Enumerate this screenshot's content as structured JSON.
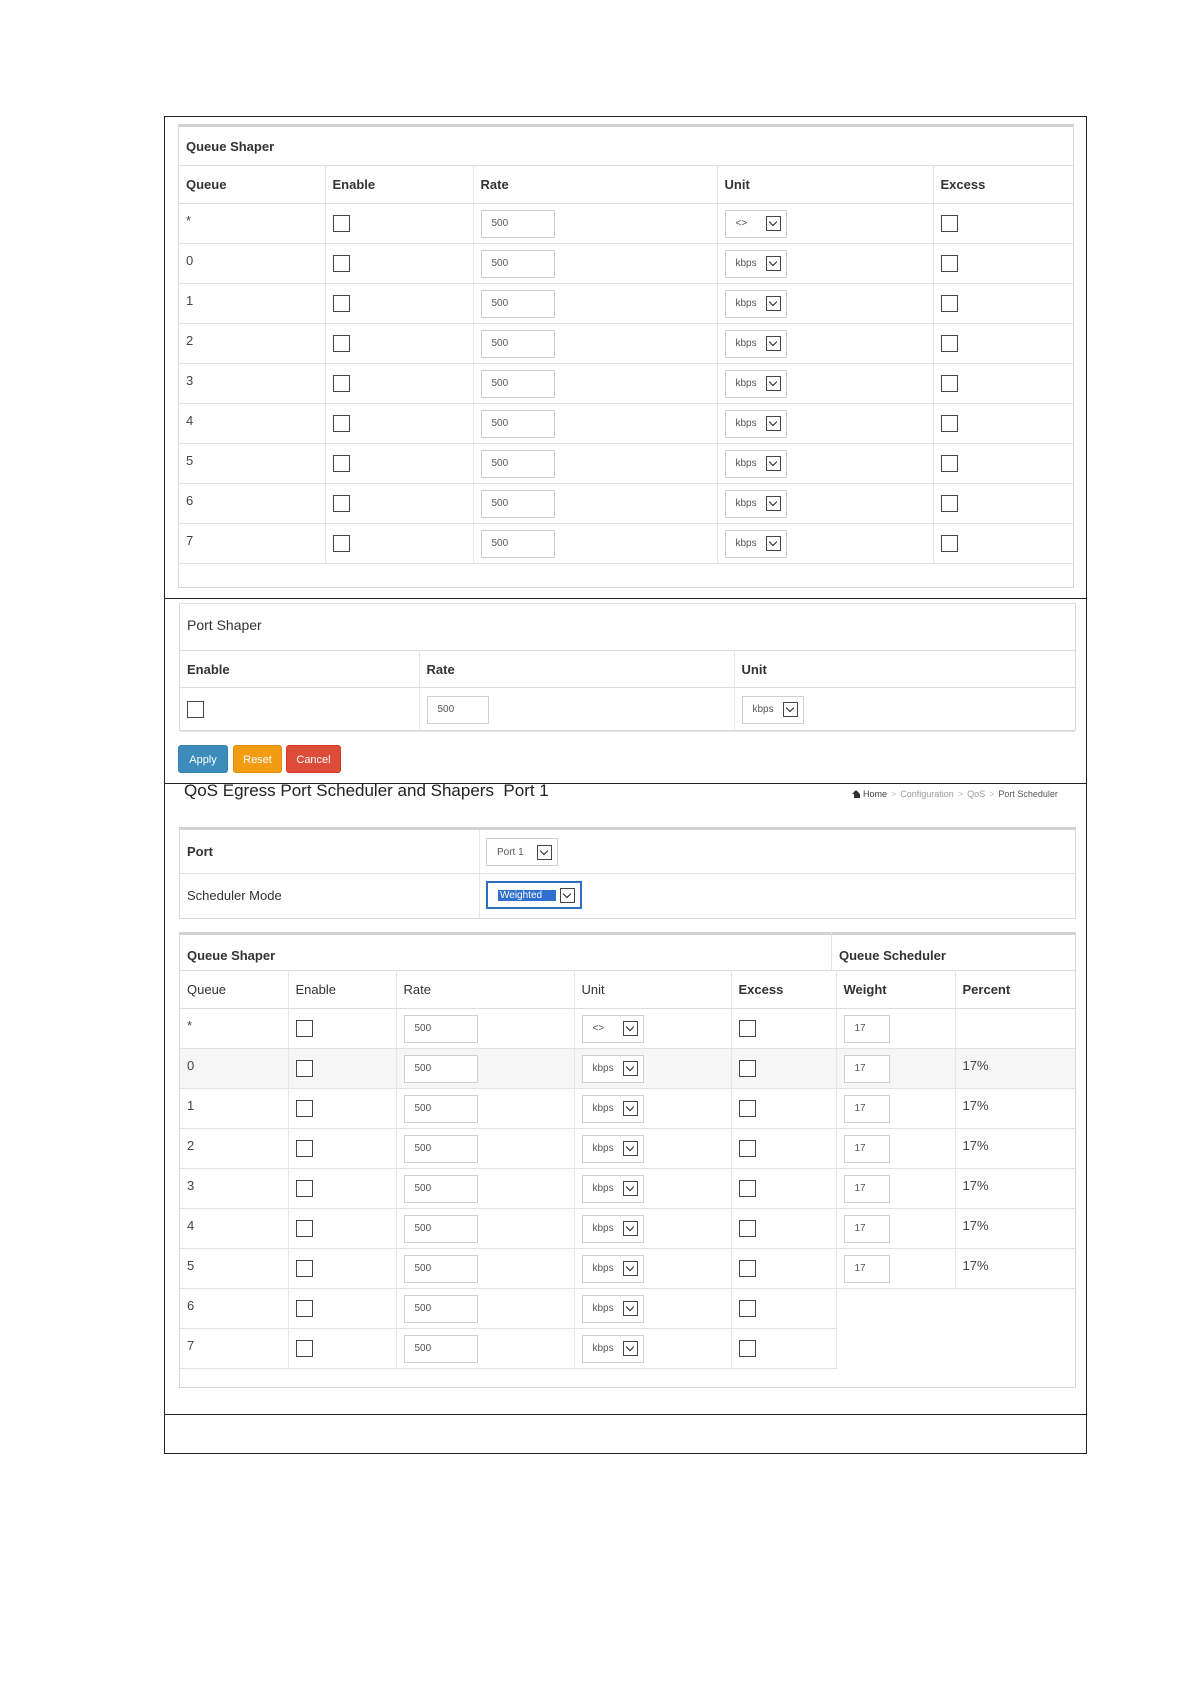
{
  "queue_shaper_top": {
    "title": "Queue Shaper",
    "headers": {
      "queue": "Queue",
      "enable": "Enable",
      "rate": "Rate",
      "unit": "Unit",
      "excess": "Excess"
    },
    "rows": [
      {
        "queue": "*",
        "rate": "500",
        "unit": "<>"
      },
      {
        "queue": "0",
        "rate": "500",
        "unit": "kbps"
      },
      {
        "queue": "1",
        "rate": "500",
        "unit": "kbps"
      },
      {
        "queue": "2",
        "rate": "500",
        "unit": "kbps"
      },
      {
        "queue": "3",
        "rate": "500",
        "unit": "kbps"
      },
      {
        "queue": "4",
        "rate": "500",
        "unit": "kbps"
      },
      {
        "queue": "5",
        "rate": "500",
        "unit": "kbps"
      },
      {
        "queue": "6",
        "rate": "500",
        "unit": "kbps"
      },
      {
        "queue": "7",
        "rate": "500",
        "unit": "kbps"
      }
    ]
  },
  "port_shaper": {
    "title": "Port Shaper",
    "headers": {
      "enable": "Enable",
      "rate": "Rate",
      "unit": "Unit"
    },
    "rate": "500",
    "unit": "kbps"
  },
  "buttons": {
    "apply": "Apply",
    "reset": "Reset",
    "cancel": "Cancel"
  },
  "page": {
    "heading": "QoS Egress Port Scheduler and Shapers  Port 1",
    "breadcrumb": {
      "home": "Home",
      "configuration": "Configuration",
      "qos": "QoS",
      "current": "Port Scheduler",
      "separator": ">"
    }
  },
  "port_settings": {
    "port_label": "Port",
    "port_value": "Port 1",
    "mode_label": "Scheduler Mode",
    "mode_value": "Weighted"
  },
  "queue_table": {
    "shaper_title": "Queue Shaper",
    "scheduler_title": "Queue Scheduler",
    "headers": {
      "queue": "Queue",
      "enable": "Enable",
      "rate": "Rate",
      "unit": "Unit",
      "excess": "Excess",
      "weight": "Weight",
      "percent": "Percent"
    },
    "rows": [
      {
        "queue": "*",
        "rate": "500",
        "unit": "<>",
        "weight": "17",
        "percent": ""
      },
      {
        "queue": "0",
        "rate": "500",
        "unit": "kbps",
        "weight": "17",
        "percent": "17%"
      },
      {
        "queue": "1",
        "rate": "500",
        "unit": "kbps",
        "weight": "17",
        "percent": "17%"
      },
      {
        "queue": "2",
        "rate": "500",
        "unit": "kbps",
        "weight": "17",
        "percent": "17%"
      },
      {
        "queue": "3",
        "rate": "500",
        "unit": "kbps",
        "weight": "17",
        "percent": "17%"
      },
      {
        "queue": "4",
        "rate": "500",
        "unit": "kbps",
        "weight": "17",
        "percent": "17%"
      },
      {
        "queue": "5",
        "rate": "500",
        "unit": "kbps",
        "weight": "17",
        "percent": "17%"
      },
      {
        "queue": "6",
        "rate": "500",
        "unit": "kbps"
      },
      {
        "queue": "7",
        "rate": "500",
        "unit": "kbps"
      }
    ]
  },
  "colors": {
    "apply": "#3c8dbc",
    "reset": "#f39c12",
    "cancel": "#dd4b39",
    "selection": "#2f6fd0"
  }
}
